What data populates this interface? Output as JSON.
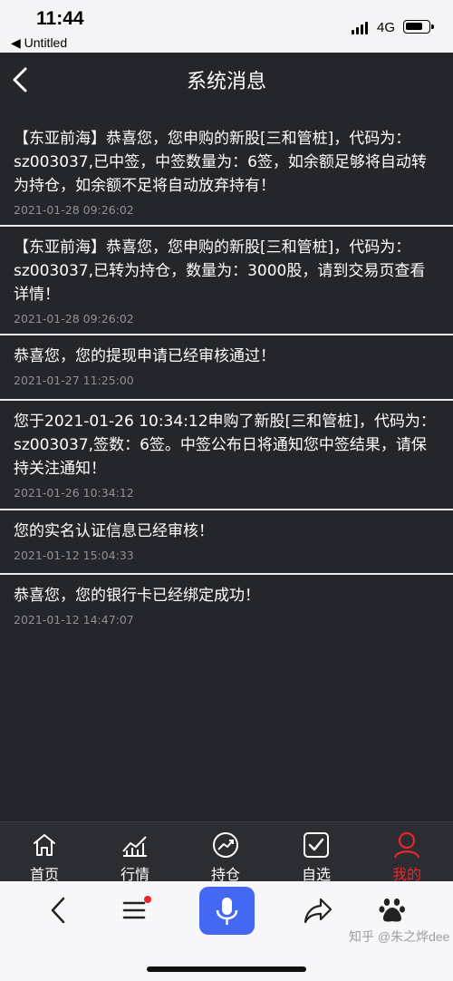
{
  "status_bar": {
    "time": "11:44",
    "back_app": "◀ Untitled",
    "network": "4G"
  },
  "header": {
    "title": "系统消息"
  },
  "messages": [
    {
      "text": "【东亚前海】恭喜您，您申购的新股[三和管桩]，代码为：sz003037,已中签，中签数量为：6签，如余额足够将自动转为持仓，如余额不足将自动放弃持有！",
      "time": "2021-01-28 09:26:02"
    },
    {
      "text": "【东亚前海】恭喜您，您申购的新股[三和管桩]，代码为：sz003037,已转为持仓，数量为：3000股，请到交易页查看详情！",
      "time": "2021-01-28 09:26:02"
    },
    {
      "text": "恭喜您，您的提现申请已经审核通过！",
      "time": "2021-01-27 11:25:00"
    },
    {
      "text": "您于2021-01-26 10:34:12申购了新股[三和管桩]，代码为：sz003037,签数：6签。中签公布日将通知您中签结果，请保持关注通知！",
      "time": "2021-01-26 10:34:12"
    },
    {
      "text": "您的实名认证信息已经审核！",
      "time": "2021-01-12 15:04:33"
    },
    {
      "text": "恭喜您，您的银行卡已经绑定成功！",
      "time": "2021-01-12 14:47:07"
    }
  ],
  "tabs": [
    {
      "label": "首页",
      "icon": "home-icon"
    },
    {
      "label": "行情",
      "icon": "market-chart-icon"
    },
    {
      "label": "持仓",
      "icon": "trend-up-icon"
    },
    {
      "label": "自选",
      "icon": "checkbox-icon"
    },
    {
      "label": "我的",
      "icon": "user-icon",
      "active": true
    }
  ],
  "browser_bar": {
    "watermark": "知乎 @朱之烨dee"
  },
  "colors": {
    "background": "#25262b",
    "accent_active": "#e8272d",
    "mic_button": "#4468f2",
    "divider": "#e9e9e9"
  }
}
